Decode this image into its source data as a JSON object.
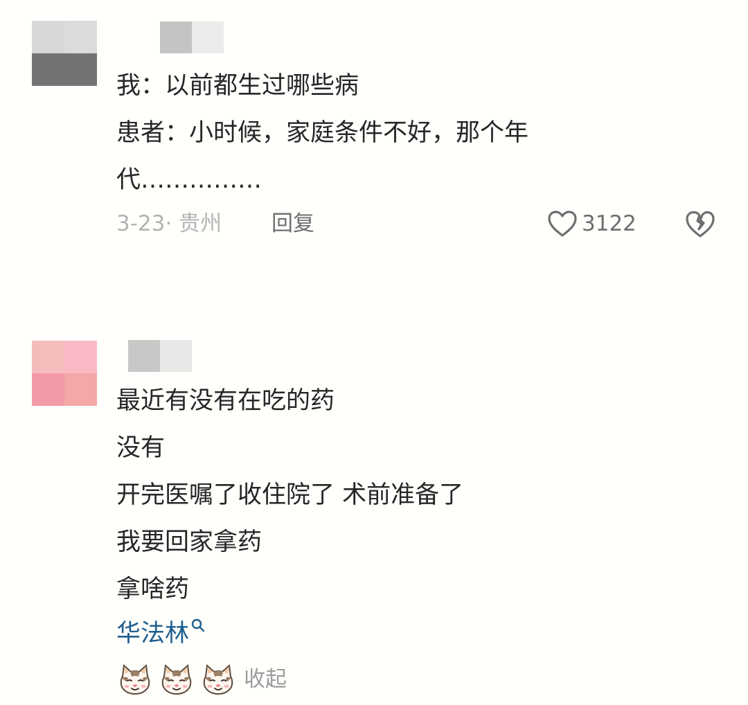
{
  "comments": [
    {
      "lines": [
        "我：以前都生过哪些病",
        "患者：小时候，家庭条件不好，那个年",
        "代……………"
      ],
      "date_location": "3-23· 贵州",
      "reply_label": "回复",
      "like_count": "3122",
      "avatar_colors": [
        "#d8d8d8",
        "#dcdcdc",
        "#737373",
        "#737373"
      ],
      "username_colors": [
        "#c4c4c4",
        "#ececec"
      ]
    },
    {
      "lines": [
        "最近有没有在吃的药",
        "没有",
        "开完医嘱了收住院了 术前准备了",
        "我要回家拿药",
        "拿啥药"
      ],
      "link_text": "华法林",
      "emoji_icons": [
        "cat-face-icon",
        "cat-face-icon",
        "cat-face-icon"
      ],
      "collapse_label": "收起",
      "avatar_colors": [
        "#f5bcbc",
        "#f9b9c5",
        "#f29aa6",
        "#f4a8a8"
      ],
      "username_colors": [
        "#c8c8c8",
        "#e8e8e8"
      ]
    }
  ],
  "colors": {
    "text": "#262626",
    "meta": "#b3b3b3",
    "action": "#6e6e6e",
    "link": "#1e5f8f"
  }
}
